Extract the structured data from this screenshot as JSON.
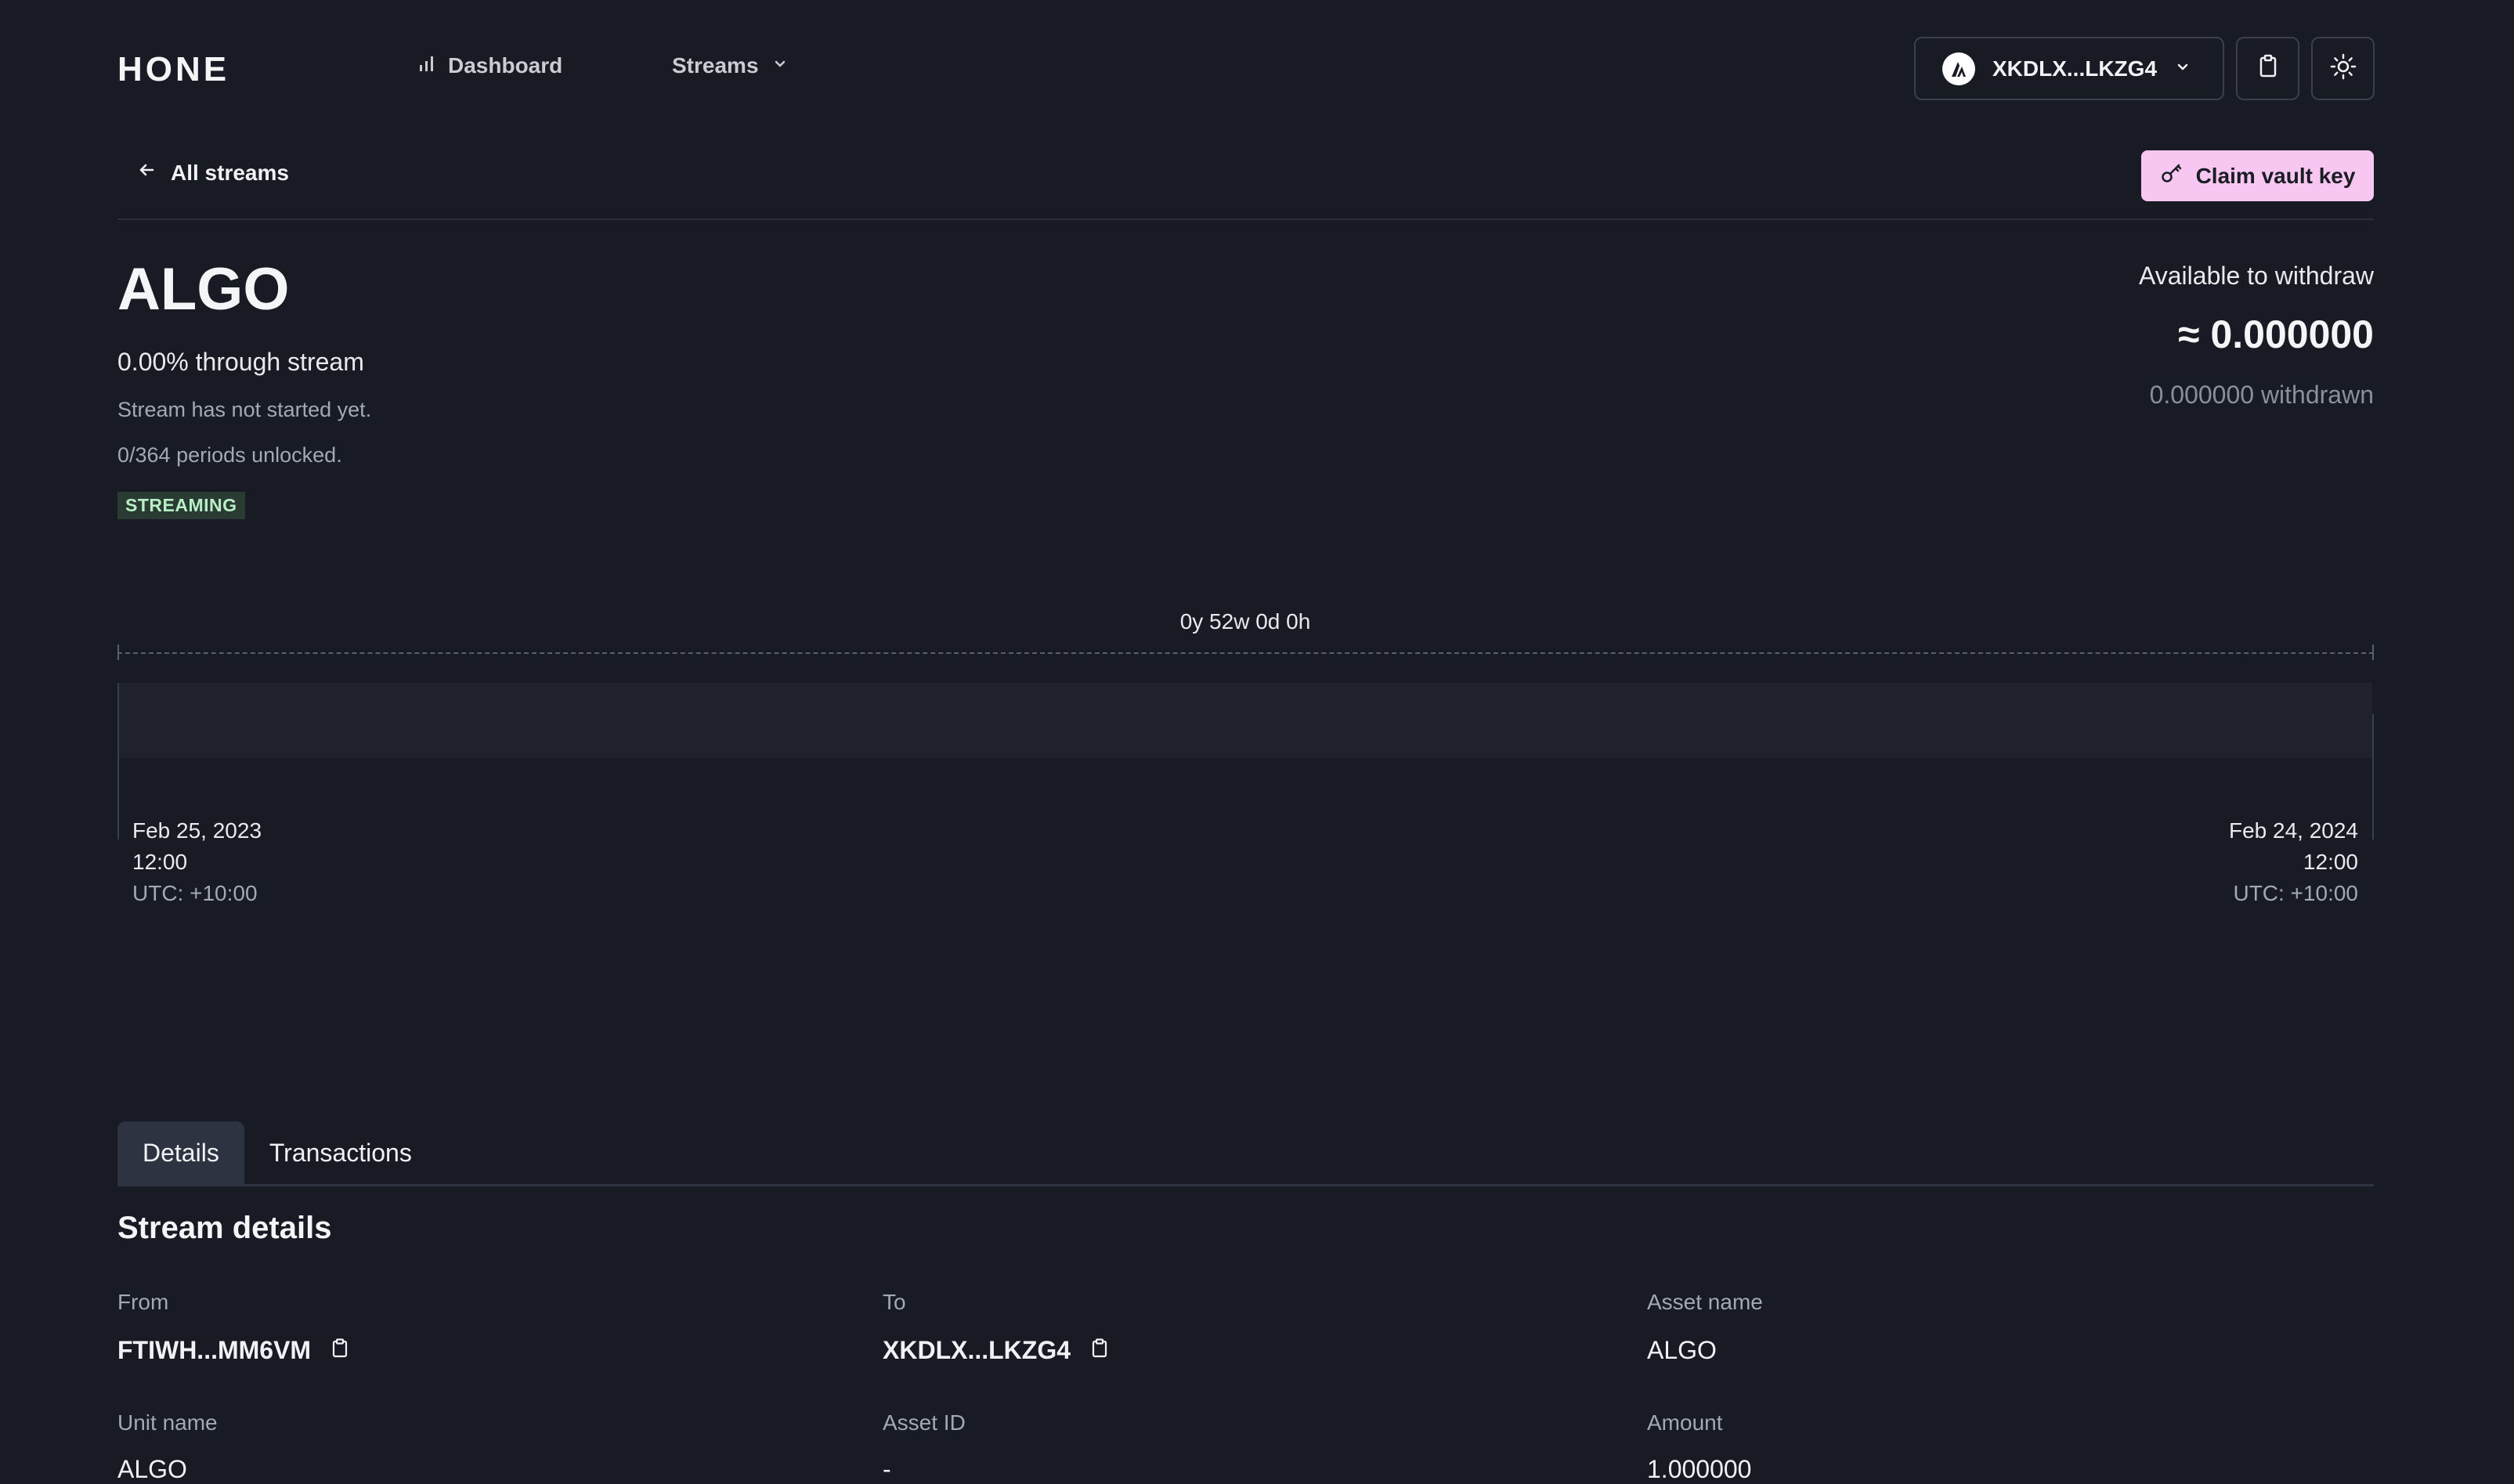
{
  "header": {
    "logo": "HONE",
    "nav": {
      "dashboard_label": "Dashboard",
      "streams_label": "Streams"
    },
    "wallet_address": "XKDLX...LKZG4"
  },
  "subheader": {
    "back_label": "All streams",
    "claim_label": "Claim vault key"
  },
  "stream": {
    "asset": "ALGO",
    "progress_text": "0.00% through stream",
    "status_text": "Stream has not started yet.",
    "periods_text": "0/364 periods unlocked.",
    "badge": "STREAMING",
    "progress_fraction": 0.0
  },
  "withdraw": {
    "label": "Available to withdraw",
    "amount": "≈ 0.000000",
    "withdrawn": "0.000000 withdrawn"
  },
  "timeline": {
    "duration": "0y 52w 0d 0h",
    "start": {
      "date": "Feb 25, 2023",
      "time": "12:00",
      "tz": "UTC: +10:00"
    },
    "end": {
      "date": "Feb 24, 2024",
      "time": "12:00",
      "tz": "UTC: +10:00"
    }
  },
  "tabs": [
    {
      "label": "Details",
      "active": true
    },
    {
      "label": "Transactions",
      "active": false
    }
  ],
  "details": {
    "title": "Stream details",
    "fields": [
      {
        "label": "From",
        "value": "FTIWH...MM6VM",
        "copy": true
      },
      {
        "label": "To",
        "value": "XKDLX...LKZG4",
        "copy": true
      },
      {
        "label": "Asset name",
        "value": "ALGO",
        "copy": false
      },
      {
        "label": "Unit name",
        "value": "ALGO",
        "copy": false
      },
      {
        "label": "Asset ID",
        "value": "-",
        "copy": false
      },
      {
        "label": "Amount",
        "value": "1.000000",
        "copy": false
      }
    ]
  },
  "colors": {
    "background": "#181b23",
    "accent_pink": "#f7c7f2",
    "badge_bg": "#2a3b33",
    "badge_text": "#b8efc6"
  },
  "icons": [
    "bar-chart-icon",
    "chevron-down-icon",
    "algorand-icon",
    "clipboard-icon",
    "sun-icon",
    "arrow-left-icon",
    "key-icon",
    "copy-icon"
  ]
}
